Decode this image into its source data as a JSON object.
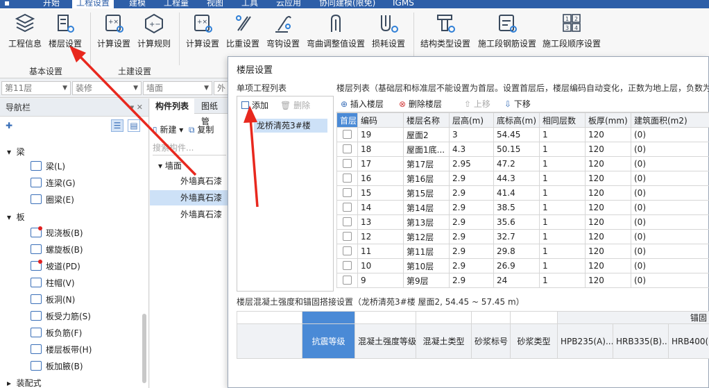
{
  "menu": {
    "items": [
      "开始",
      "工程设置",
      "建模",
      "工程量",
      "视图",
      "工具",
      "云应用",
      "协同建模(限免)",
      "IGMS"
    ],
    "active_index": 1
  },
  "ribbon": {
    "buttons": [
      {
        "label": "工程信息",
        "icon": "project-info-icon"
      },
      {
        "label": "楼层设置",
        "icon": "floor-settings-icon"
      },
      {
        "label": "计算设置",
        "icon": "calc-settings-icon"
      },
      {
        "label": "计算规则",
        "icon": "calc-rules-icon"
      },
      {
        "label": "计算设置",
        "icon": "rebar-calc-settings-icon"
      },
      {
        "label": "比重设置",
        "icon": "density-settings-icon"
      },
      {
        "label": "弯钩设置",
        "icon": "hook-settings-icon"
      },
      {
        "label": "弯曲调整值设置",
        "icon": "bend-adjust-icon"
      },
      {
        "label": "损耗设置",
        "icon": "loss-settings-icon"
      },
      {
        "label": "结构类型设置",
        "icon": "structure-type-icon"
      },
      {
        "label": "施工段钢筋设置",
        "icon": "segment-rebar-icon"
      },
      {
        "label": "施工段顺序设置",
        "icon": "segment-order-icon"
      }
    ],
    "groups": [
      "基本设置",
      "土建设置"
    ]
  },
  "selectors": [
    {
      "value": "第11层"
    },
    {
      "value": "装修"
    },
    {
      "value": "墙面"
    },
    {
      "value": "外"
    }
  ],
  "nav": {
    "title": "导航栏",
    "groups": [
      {
        "label": "梁",
        "items": [
          "梁(L)",
          "连梁(G)",
          "圈梁(E)"
        ]
      },
      {
        "label": "板",
        "items": [
          "现浇板(B)",
          "螺旋板(B)",
          "坡道(PD)",
          "柱帽(V)",
          "板洞(N)",
          "板受力筋(S)",
          "板负筋(F)",
          "楼层板带(H)",
          "板加腋(B)"
        ]
      },
      {
        "label": "装配式",
        "items": []
      }
    ]
  },
  "components": {
    "tabs": [
      "构件列表",
      "图纸管"
    ],
    "new_label": "新建",
    "copy_label": "复制",
    "search_placeholder": "搜索构件...",
    "group": "墙面",
    "rows": [
      "外墙真石漆",
      "外墙真石漆",
      "外墙真石漆"
    ],
    "selected_index": 1
  },
  "dialog": {
    "title": "楼层设置",
    "project_list_title": "单项工程列表",
    "add_label": "添加",
    "delete_label": "删除",
    "project_item": "龙桥清苑3#楼",
    "floor_list_title": "楼层列表（基础层和标准层不能设置为首层。设置首层后，楼层编码自动变化，正数为地上层，负数为",
    "insert_label": "插入楼层",
    "delete_floor_label": "删除楼层",
    "up_label": "上移",
    "down_label": "下移",
    "floor_headers": [
      "首层",
      "编码",
      "楼层名称",
      "层高(m)",
      "底标高(m)",
      "相同层数",
      "板厚(mm)",
      "建筑面积(m2)"
    ],
    "floors": [
      [
        "19",
        "屋面2",
        "3",
        "54.45",
        "1",
        "120",
        "(0)"
      ],
      [
        "18",
        "屋面1底...",
        "4.3",
        "50.15",
        "1",
        "120",
        "(0)"
      ],
      [
        "17",
        "第17层",
        "2.95",
        "47.2",
        "1",
        "120",
        "(0)"
      ],
      [
        "16",
        "第16层",
        "2.9",
        "44.3",
        "1",
        "120",
        "(0)"
      ],
      [
        "15",
        "第15层",
        "2.9",
        "41.4",
        "1",
        "120",
        "(0)"
      ],
      [
        "14",
        "第14层",
        "2.9",
        "38.5",
        "1",
        "120",
        "(0)"
      ],
      [
        "13",
        "第13层",
        "2.9",
        "35.6",
        "1",
        "120",
        "(0)"
      ],
      [
        "12",
        "第12层",
        "2.9",
        "32.7",
        "1",
        "120",
        "(0)"
      ],
      [
        "11",
        "第11层",
        "2.9",
        "29.8",
        "1",
        "120",
        "(0)"
      ],
      [
        "10",
        "第10层",
        "2.9",
        "26.9",
        "1",
        "120",
        "(0)"
      ],
      [
        "9",
        "第9层",
        "2.9",
        "24",
        "1",
        "120",
        "(0)"
      ]
    ],
    "concrete_title": "楼层混凝土强度和锚固搭接设置（龙桥清苑3#楼  屋面2, 54.45 ~ 57.45 m）",
    "concrete_headers": [
      "抗震等级",
      "混凝土强度等级",
      "混凝土类型",
      "砂浆标号",
      "砂浆类型",
      "HPB235(A)...",
      "HRB335(B)...",
      "HRB400(..."
    ],
    "anchor_label": "锚固"
  },
  "colors": {
    "menubar": "#2e5fa8",
    "accent": "#4a8ad6",
    "selection": "#cde1f7",
    "annotation": "#e8281e"
  }
}
